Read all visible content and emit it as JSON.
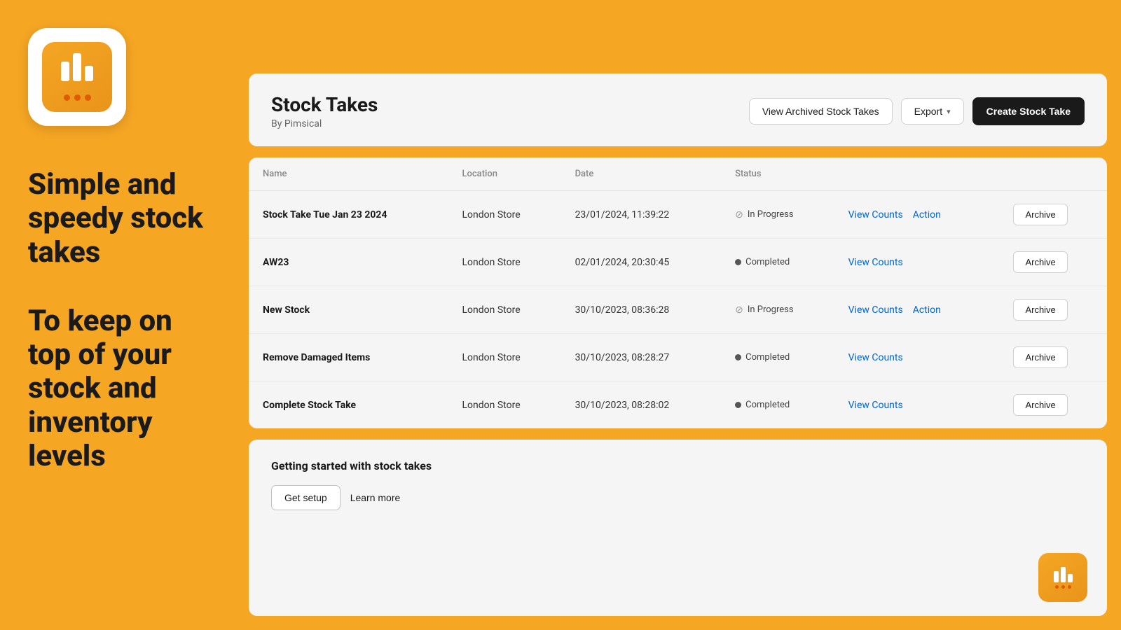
{
  "background_color": "#F5A623",
  "left": {
    "tagline_1": "Simple and speedy stock takes",
    "tagline_2": "To keep on top of your stock and inventory levels"
  },
  "header": {
    "title": "Stock Takes",
    "subtitle": "By Pimsical",
    "view_archived_label": "View Archived Stock Takes",
    "export_label": "Export",
    "create_label": "Create Stock Take"
  },
  "table": {
    "columns": [
      "Name",
      "Location",
      "Date",
      "Status",
      "",
      ""
    ],
    "rows": [
      {
        "name": "Stock Take Tue Jan 23 2024",
        "location": "London Store",
        "date": "23/01/2024, 11:39:22",
        "status": "In Progress",
        "status_type": "in_progress",
        "has_action": true
      },
      {
        "name": "AW23",
        "location": "London Store",
        "date": "02/01/2024, 20:30:45",
        "status": "Completed",
        "status_type": "completed",
        "has_action": false
      },
      {
        "name": "New Stock",
        "location": "London Store",
        "date": "30/10/2023, 08:36:28",
        "status": "In Progress",
        "status_type": "in_progress",
        "has_action": true
      },
      {
        "name": "Remove Damaged Items",
        "location": "London Store",
        "date": "30/10/2023, 08:28:27",
        "status": "Completed",
        "status_type": "completed",
        "has_action": false
      },
      {
        "name": "Complete Stock Take",
        "location": "London Store",
        "date": "30/10/2023, 08:28:02",
        "status": "Completed",
        "status_type": "completed",
        "has_action": false
      }
    ],
    "view_counts_label": "View Counts",
    "action_label": "Action",
    "archive_label": "Archive"
  },
  "getting_started": {
    "title": "Getting started with stock takes",
    "setup_label": "Get setup",
    "learn_more_label": "Learn more"
  }
}
